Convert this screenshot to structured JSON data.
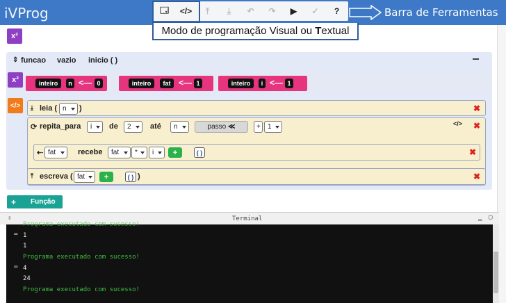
{
  "app": {
    "title": "iVProg"
  },
  "toolbar": {
    "buttons": [
      {
        "icon": "visual-mode-icon",
        "glyph": "🗔"
      },
      {
        "icon": "textual-mode-icon",
        "glyph": "</>"
      },
      {
        "icon": "upload-icon",
        "glyph": "⤒"
      },
      {
        "icon": "download-icon",
        "glyph": "⤓"
      },
      {
        "icon": "undo-icon",
        "glyph": "↶"
      },
      {
        "icon": "redo-icon",
        "glyph": "↷"
      },
      {
        "icon": "play-icon",
        "glyph": "▶"
      },
      {
        "icon": "check-icon",
        "glyph": "✓"
      },
      {
        "icon": "help-icon",
        "glyph": "?"
      }
    ]
  },
  "annotations": {
    "mode_label_pre": "Modo de programação Visual ou ",
    "mode_label_bold": "T",
    "mode_label_post": "extual",
    "toolbar_label": "Barra de Ferramentas"
  },
  "function": {
    "label_funcao": "funcao",
    "return_type": "vazio",
    "name": "inicio ( )",
    "variables": [
      {
        "type": "inteiro",
        "name": "n",
        "arrow": "<—",
        "value": "0"
      },
      {
        "type": "inteiro",
        "name": "fat",
        "arrow": "<—",
        "value": "1"
      },
      {
        "type": "inteiro",
        "name": "i",
        "arrow": "<—",
        "value": "1"
      }
    ]
  },
  "commands": {
    "read": {
      "keyword": "leia (",
      "var": "n",
      "close": ")"
    },
    "for": {
      "keyword": "repita_para",
      "var": "i",
      "de": "de",
      "from": "2",
      "ate": "até",
      "to": "n",
      "step_label": "passo",
      "step_glyph": "≪",
      "step_op": "+",
      "step_value": "1",
      "code_glyph": "</>"
    },
    "assign": {
      "var": "fat",
      "keyword": "recebe",
      "lhs": "fat",
      "op": "*",
      "rhs": "i",
      "plus": "+",
      "paren": "( )"
    },
    "write": {
      "keyword": "escreva (",
      "var": "fat",
      "plus": "+",
      "paren": "( )",
      "close": ")"
    }
  },
  "add_function": {
    "plus": "+",
    "label": "Função"
  },
  "terminal": {
    "title": "Terminal",
    "lines": [
      {
        "kind": "green",
        "text": "Programa executado com sucesso!"
      },
      {
        "kind": "input",
        "text": "1"
      },
      {
        "kind": "white",
        "text": "1"
      },
      {
        "kind": "green",
        "text": "Programa executado com sucesso!"
      },
      {
        "kind": "input",
        "text": "4"
      },
      {
        "kind": "white",
        "text": "24"
      },
      {
        "kind": "green",
        "text": "Programa executado com sucesso!"
      }
    ]
  }
}
